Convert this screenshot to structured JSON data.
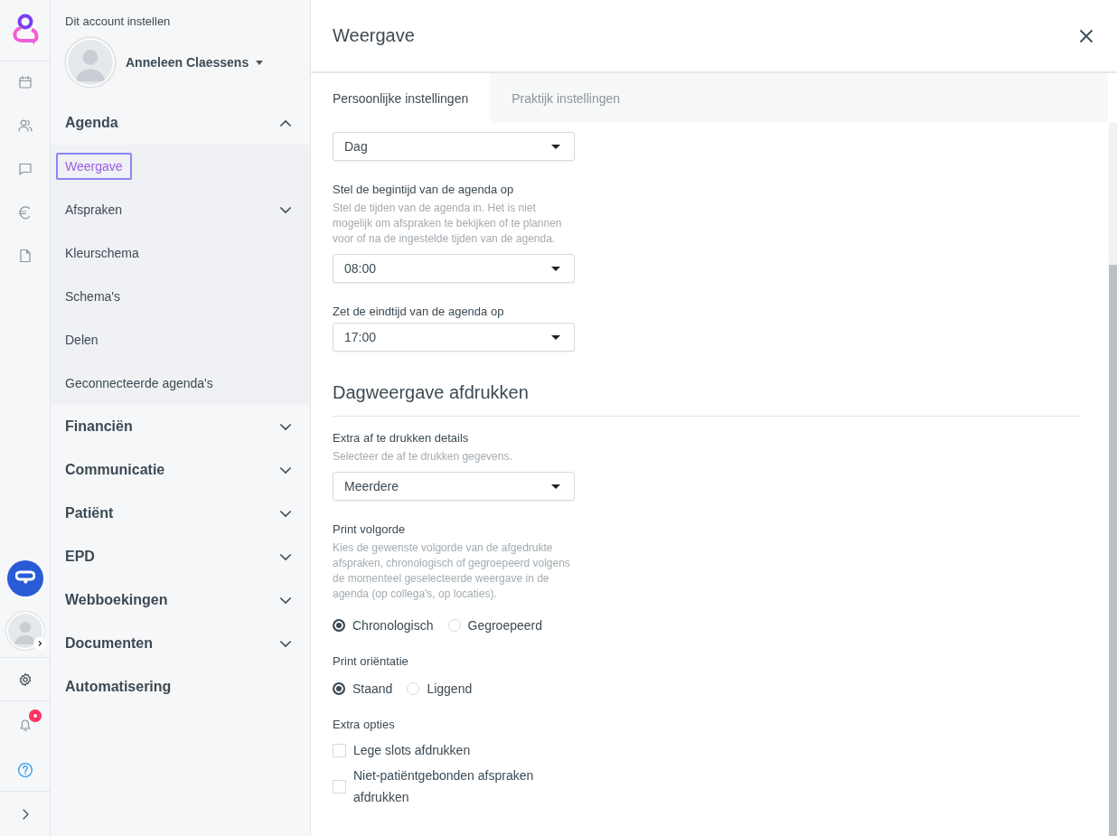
{
  "settings_menu": {
    "heading": "Dit account instellen",
    "user_name": "Anneleen Claessens",
    "sections": [
      {
        "kind": "group",
        "label": "Agenda",
        "expanded": true,
        "items": [
          {
            "label": "Weergave",
            "selected": true,
            "kind": "link"
          },
          {
            "label": "Afspraken",
            "selected": false,
            "kind": "group",
            "expanded": false
          },
          {
            "label": "Kleurschema",
            "selected": false,
            "kind": "link"
          },
          {
            "label": "Schema's",
            "selected": false,
            "kind": "link"
          },
          {
            "label": "Delen",
            "selected": false,
            "kind": "link"
          },
          {
            "label": "Geconnecteerde agenda's",
            "selected": false,
            "kind": "link"
          }
        ]
      },
      {
        "kind": "group",
        "label": "Financiën",
        "expanded": false
      },
      {
        "kind": "group",
        "label": "Communicatie",
        "expanded": false
      },
      {
        "kind": "group",
        "label": "Patiënt",
        "expanded": false
      },
      {
        "kind": "group",
        "label": "EPD",
        "expanded": false
      },
      {
        "kind": "group",
        "label": "Webboekingen",
        "expanded": false
      },
      {
        "kind": "group",
        "label": "Documenten",
        "expanded": false
      },
      {
        "kind": "link",
        "label": "Automatisering"
      }
    ]
  },
  "panel": {
    "title": "Weergave",
    "tabs": [
      {
        "label": "Persoonlijke instellingen",
        "selected": true
      },
      {
        "label": "Praktijk instellingen",
        "selected": false
      }
    ],
    "fields": [
      {
        "kind": "select",
        "value": "Dag"
      },
      {
        "kind": "select",
        "label": "Stel de begintijd van de agenda op",
        "hint": "Stel de tijden van de agenda in. Het is niet mogelijk om afspraken te bekijken of te plannen voor of na de ingestelde tijden van de agenda.",
        "value": "08:00"
      },
      {
        "kind": "select",
        "label": "Zet de eindtijd van de agenda op",
        "value": "17:00"
      },
      {
        "kind": "heading",
        "label": "Dagweergave afdrukken"
      },
      {
        "kind": "select",
        "label": "Extra af te drukken details",
        "hint": "Selecteer de af te drukken gegevens.",
        "value": "Meerdere"
      },
      {
        "kind": "radio",
        "label": "Print volgorde",
        "hint": "Kies de gewenste volgorde van de afgedrukte afspraken, chronologisch of gegroepeerd volgens de momenteel geselecteerde weergave in de agenda (op collega's, op locaties).",
        "options": [
          {
            "label": "Chronologisch",
            "selected": true
          },
          {
            "label": "Gegroepeerd",
            "selected": false
          }
        ]
      },
      {
        "kind": "radio",
        "label": "Print oriëntatie",
        "options": [
          {
            "label": "Staand",
            "selected": true
          },
          {
            "label": "Liggend",
            "selected": false
          }
        ]
      },
      {
        "kind": "checkbox",
        "label": "Extra opties",
        "options": [
          {
            "label": "Lege slots afdrukken",
            "checked": false
          },
          {
            "label": "Niet-patiëntgebonden afspraken afdrukken",
            "checked": false
          }
        ]
      }
    ]
  },
  "notifications": {
    "unread": true
  }
}
